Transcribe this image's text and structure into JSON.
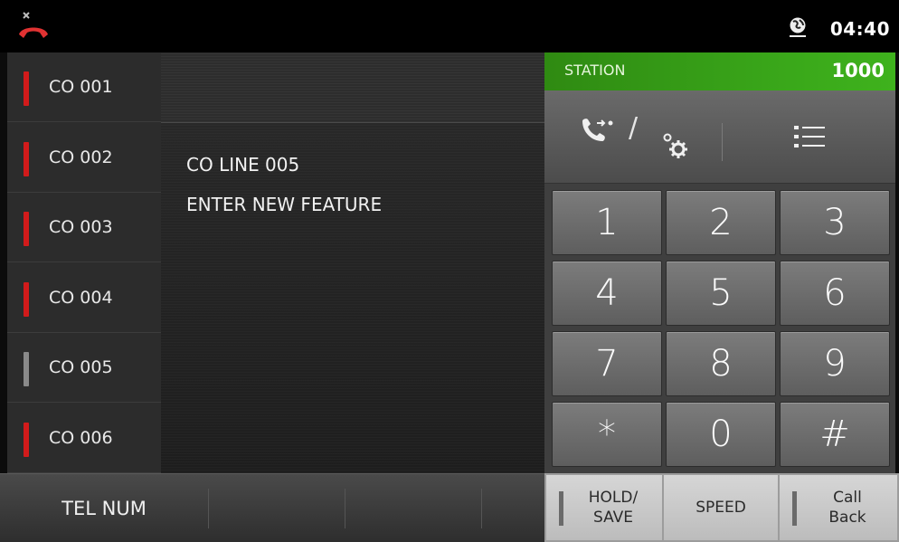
{
  "status_bar": {
    "time": "04:40",
    "hangup_icon": "hangup-phone-icon",
    "network_icon": "globe-icon"
  },
  "colors": {
    "led_active": "#d21b1b",
    "led_idle": "#8a8a8a",
    "station_bar": "#38a418"
  },
  "co_lines": [
    {
      "label": "CO 001",
      "state": "active"
    },
    {
      "label": "CO 002",
      "state": "active"
    },
    {
      "label": "CO 003",
      "state": "active"
    },
    {
      "label": "CO 004",
      "state": "active"
    },
    {
      "label": "CO 005",
      "state": "idle"
    },
    {
      "label": "CO 006",
      "state": "active"
    }
  ],
  "display": {
    "line1": "CO LINE 005",
    "line2": "ENTER NEW FEATURE"
  },
  "station": {
    "label": "STATION",
    "number": "1000"
  },
  "tools": {
    "transfer_icon": "call-transfer-icon",
    "separator": "/",
    "settings_icon": "gear-icon",
    "menu_icon": "list-icon"
  },
  "keypad": [
    "1",
    "2",
    "3",
    "4",
    "5",
    "6",
    "7",
    "8",
    "9",
    "*",
    "0",
    "#"
  ],
  "bottom": {
    "softkeys": [
      "TEL NUM",
      "",
      "",
      ""
    ],
    "hold_save": "HOLD/\nSAVE",
    "speed": "SPEED",
    "call_back": "Call\nBack"
  }
}
